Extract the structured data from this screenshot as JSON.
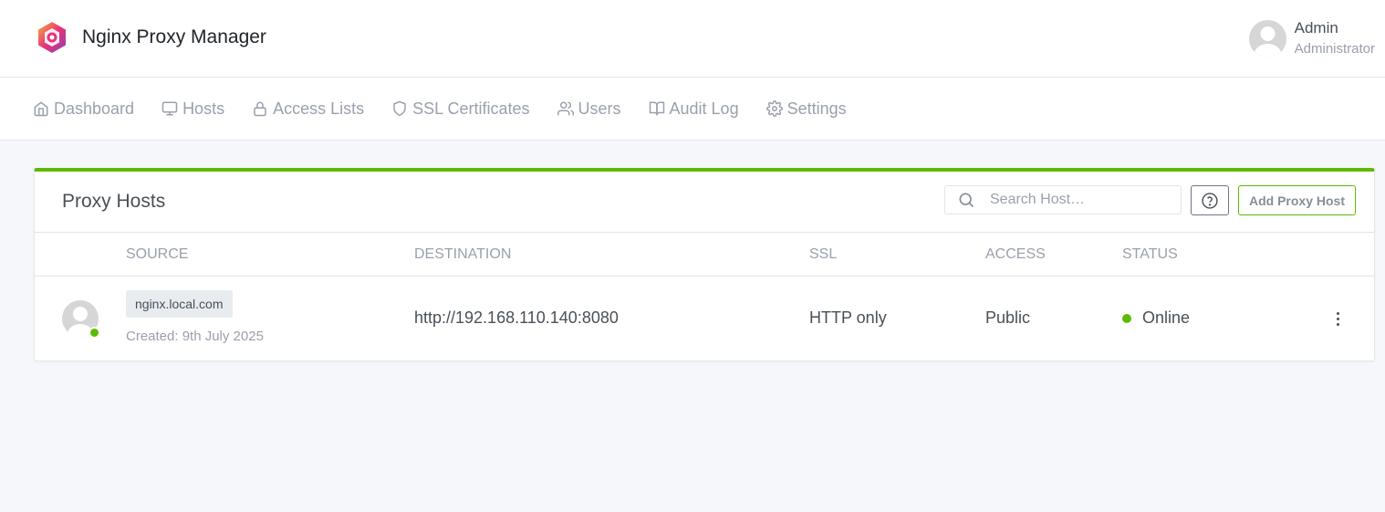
{
  "app": {
    "title": "Nginx Proxy Manager"
  },
  "user": {
    "name": "Admin",
    "role": "Administrator"
  },
  "nav": {
    "items": [
      {
        "label": "Dashboard",
        "icon": "home-icon"
      },
      {
        "label": "Hosts",
        "icon": "monitor-icon"
      },
      {
        "label": "Access Lists",
        "icon": "lock-icon"
      },
      {
        "label": "SSL Certificates",
        "icon": "shield-icon"
      },
      {
        "label": "Users",
        "icon": "users-icon"
      },
      {
        "label": "Audit Log",
        "icon": "book-icon"
      },
      {
        "label": "Settings",
        "icon": "gear-icon"
      }
    ]
  },
  "card": {
    "title": "Proxy Hosts",
    "search_placeholder": "Search Host…",
    "add_label": "Add Proxy Host",
    "accent_color": "#5eba00"
  },
  "table": {
    "headers": {
      "source": "Source",
      "destination": "Destination",
      "ssl": "SSL",
      "access": "Access",
      "status": "Status"
    },
    "rows": [
      {
        "source": "nginx.local.com",
        "created": "Created: 9th July 2025",
        "destination": "http://192.168.110.140:8080",
        "ssl": "HTTP only",
        "access": "Public",
        "status": "Online",
        "status_color": "#5eba00"
      }
    ]
  }
}
